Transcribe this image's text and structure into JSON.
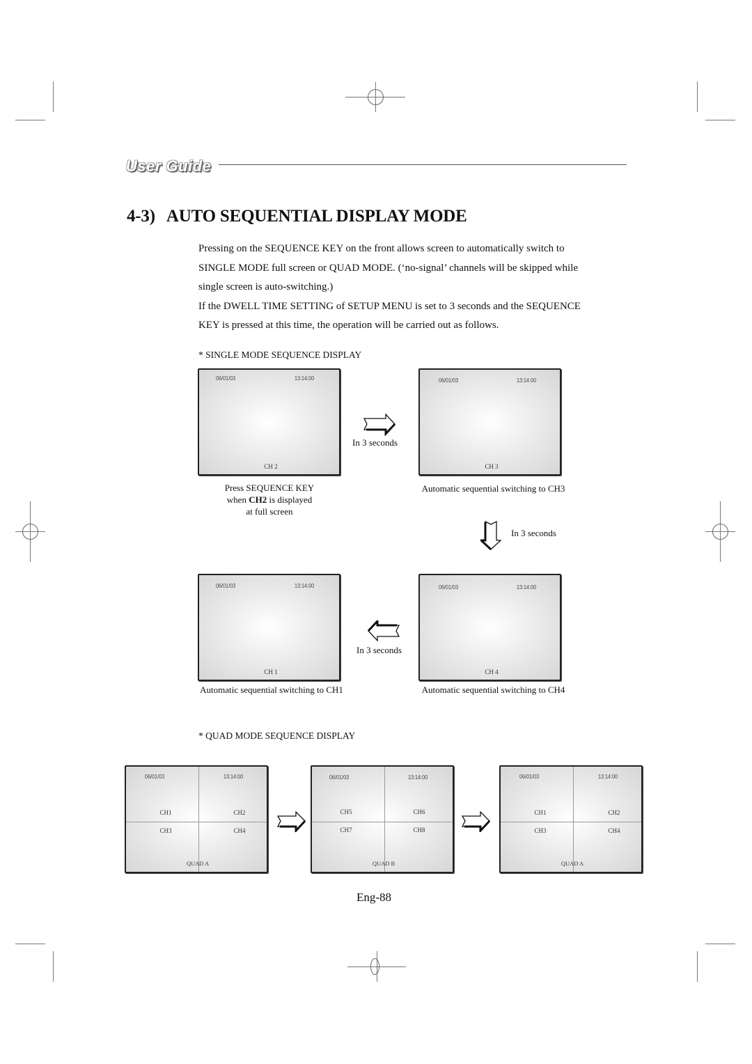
{
  "header": {
    "brand": "User Guide",
    "section_number": "4-3)",
    "section_title": "AUTO SEQUENTIAL DISPLAY MODE"
  },
  "intro": {
    "lines": [
      "Pressing on the SEQUENCE KEY on the front allows screen to automatically switch to",
      "SINGLE MODE full screen or QUAD MODE. (‘no-signal’ channels will be skipped while",
      "single screen is auto-switching.)",
      "If the DWELL TIME SETTING of SETUP MENU is set to 3 seconds and the SEQUENCE",
      "KEY is pressed at this time, the operation will be carried out as follows."
    ]
  },
  "single_mode": {
    "label": "* SINGLE MODE SEQUENCE DISPLAY",
    "monitors": [
      {
        "date": "06/01/03",
        "time": "13:14:00",
        "channel": "CH 2"
      },
      {
        "date": "06/01/03",
        "time": "13:14:00",
        "channel": "CH 3"
      },
      {
        "date": "06/01/03",
        "time": "13:14:00",
        "channel": "CH 4"
      },
      {
        "date": "06/01/03",
        "time": "13:14:00",
        "channel": "CH 1"
      }
    ],
    "captions": {
      "ch2_line1": "Press SEQUENCE KEY",
      "ch2_line2_pre": "when ",
      "ch2_line2_bold": "CH2",
      "ch2_line2_post": " is displayed",
      "ch2_line3": "at full screen",
      "ch3": "Automatic sequential switching to CH3",
      "ch4": "Automatic sequential switching to CH4",
      "ch1": "Automatic sequential switching to CH1"
    },
    "transitions": [
      "In 3 seconds",
      "In 3 seconds",
      "In 3 seconds"
    ]
  },
  "quad_mode": {
    "label": "* QUAD MODE SEQUENCE DISPLAY",
    "monitors": [
      {
        "date": "06/01/03",
        "time": "13:14:00",
        "channels": [
          "CH1",
          "CH2",
          "CH3",
          "CH4"
        ],
        "name": "QUAD A"
      },
      {
        "date": "06/01/03",
        "time": "13:14:00",
        "channels": [
          "CH5",
          "CH6",
          "CH7",
          "CH8"
        ],
        "name": "QUAD B"
      },
      {
        "date": "06/01/03",
        "time": "13:14:00",
        "channels": [
          "CH1",
          "CH2",
          "CH3",
          "CH4"
        ],
        "name": "QUAD A"
      }
    ]
  },
  "footer": {
    "page_number": "Eng-88"
  }
}
